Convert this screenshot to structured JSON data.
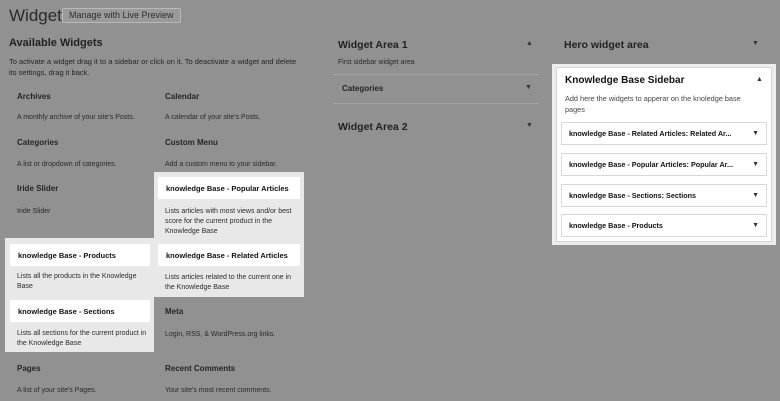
{
  "header": {
    "title": "Widgets",
    "preview_button": "Manage with Live Preview"
  },
  "available": {
    "title": "Available Widgets",
    "description": "To activate a widget drag it to a sidebar or click on it. To deactivate a widget and delete its settings, drag it back."
  },
  "widgets": {
    "archives": {
      "title": "Archives",
      "desc": "A monthly archive of your site's Posts."
    },
    "calendar": {
      "title": "Calendar",
      "desc": "A calendar of your site's Posts."
    },
    "categories": {
      "title": "Categories",
      "desc": "A list or dropdown of categories."
    },
    "custom_menu": {
      "title": "Custom Menu",
      "desc": "Add a custom menu to your sidebar."
    },
    "iride_slider": {
      "title": "Iride Slider",
      "desc": "Iride Slider"
    },
    "kb_popular": {
      "title": "knowledge Base - Popular Articles",
      "desc": "Lists articles with most views and/or best score for the current product in the Knowledge Base"
    },
    "kb_products": {
      "title": "knowledge Base - Products",
      "desc": "Lists all the products in the Knowledge Base"
    },
    "kb_related": {
      "title": "knowledge Base - Related Articles",
      "desc": "Lists articles related to the current one in the Knowledge Base"
    },
    "kb_sections": {
      "title": "knowledge Base - Sections",
      "desc": "Lists all sections for the current product in the Knowledge Base"
    },
    "meta": {
      "title": "Meta",
      "desc": "Login, RSS, & WordPress.org links."
    },
    "pages": {
      "title": "Pages",
      "desc": "A list of your site's Pages."
    },
    "recent_comments": {
      "title": "Recent Comments",
      "desc": "Your site's most recent comments."
    }
  },
  "areas": {
    "widget_area_1": {
      "title": "Widget Area 1",
      "desc": "First sidebar widget area",
      "item": "Categories"
    },
    "widget_area_2": {
      "title": "Widget Area 2"
    },
    "hero": {
      "title": "Hero widget area"
    }
  },
  "kb_sidebar": {
    "title": "Knowledge Base Sidebar",
    "desc": "Add here the widgets to apperar on the knoledge base pages",
    "items": [
      "knowledge Base - Related Articles: Related Ar...",
      "knowledge Base - Popular Articles: Popular Ar...",
      "knowledge Base - Sections: Sections",
      "knowledge Base - Products"
    ]
  },
  "icons": {
    "arrow_down": "▼",
    "arrow_up": "▲"
  }
}
